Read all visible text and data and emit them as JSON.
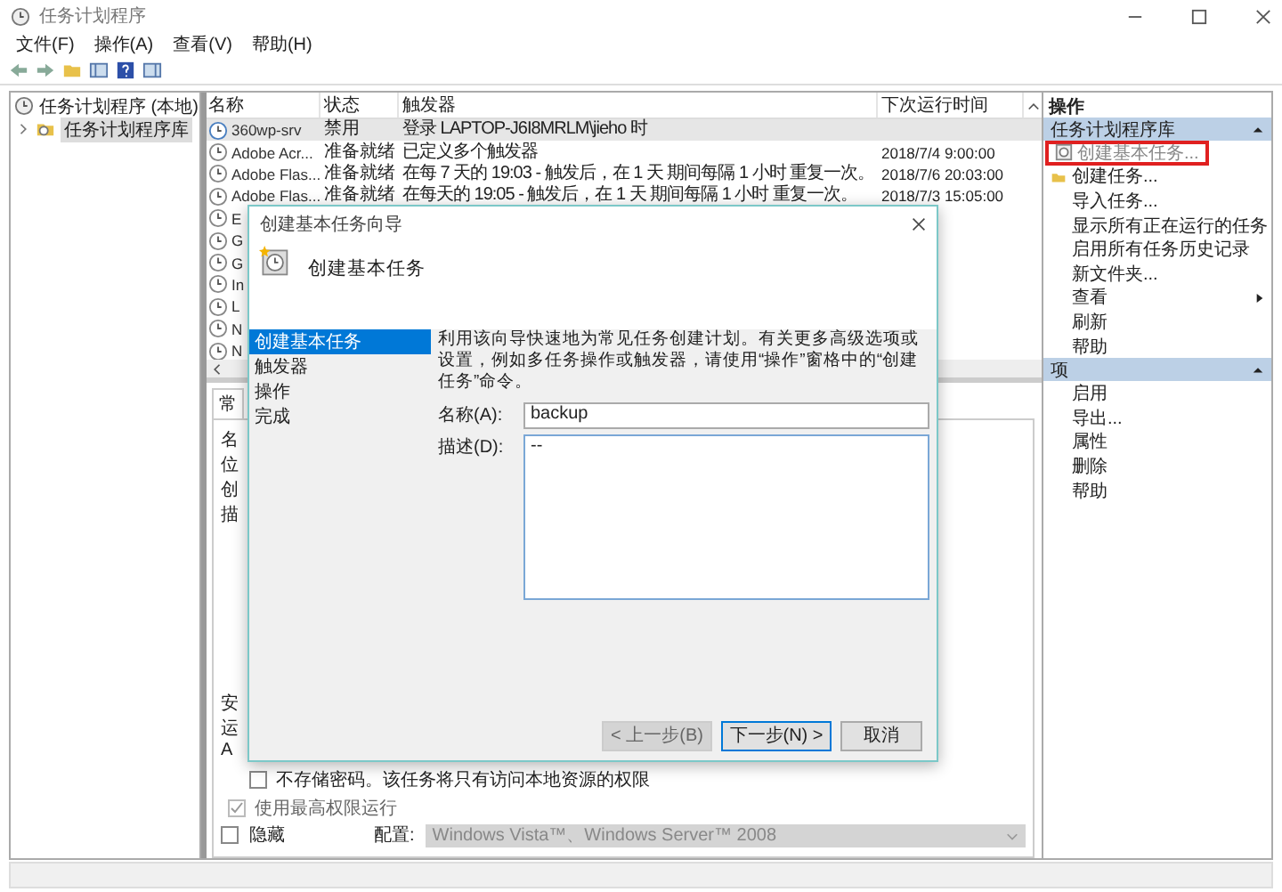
{
  "window": {
    "title": "任务计划程序",
    "menu": [
      "文件(F)",
      "操作(A)",
      "查看(V)",
      "帮助(H)"
    ]
  },
  "tree": {
    "label": "任务计划程序 (本地)",
    "children": [
      {
        "label": "任务计划程序库",
        "selected": true,
        "expanded": false
      }
    ]
  },
  "tasks": {
    "columns": [
      "名称",
      "状态",
      "触发器",
      "下次运行时间"
    ],
    "rows": [
      {
        "name": "360wp-srv",
        "status": "禁用",
        "trigger": "登录 LAPTOP-J6I8MRLM\\jieho 时",
        "selected": true
      },
      {
        "name": "Adobe Acr...",
        "status": "准备就绪",
        "trigger": "已定义多个触发器",
        "next_run": "2018/7/4 9:00:00",
        "selected": false
      },
      {
        "name": "Adobe Flas...",
        "status": "准备就绪",
        "trigger": "在每 7 天的 19:03 - 触发后，在 1 天 期间每隔 1 小时 重复一次。",
        "next_run": "2018/7/6 20:03:00",
        "selected": false
      },
      {
        "name": "Adobe Flas...",
        "status": "准备就绪",
        "trigger": "在每天的 19:05 - 触发后，在 1 天 期间每隔 1 小时 重复一次。",
        "next_run": "2018/7/3 15:05:00",
        "selected": false
      },
      {
        "name": "E",
        "selected": false
      },
      {
        "name": "G",
        "selected": false
      },
      {
        "name": "G",
        "selected": false
      },
      {
        "name": "In",
        "selected": false
      },
      {
        "name": "L",
        "selected": false
      },
      {
        "name": "N",
        "selected": false
      },
      {
        "name": "N",
        "selected": false
      }
    ]
  },
  "details": {
    "tab": "常",
    "labels": [
      "名",
      "位",
      "创",
      "描"
    ],
    "security_labels": [
      "安",
      "运",
      "A"
    ],
    "options": [
      {
        "label": "不存储密码。该任务将只有访问本地资源的权限",
        "checked": false,
        "disabled": false
      },
      {
        "label": "使用最高权限运行",
        "checked": true,
        "disabled": true
      }
    ],
    "hidden": {
      "label": "隐藏",
      "checked": false
    },
    "config": {
      "label": "配置:",
      "value": "Windows Vista™、Windows Server™ 2008",
      "disabled": true
    }
  },
  "actions": {
    "title": "操作",
    "sections": [
      {
        "title": "任务计划程序库",
        "expanded": true,
        "items": [
          {
            "label": "创建基本任务...",
            "kind": "basic-task",
            "highlighted": true
          },
          {
            "label": "创建任务...",
            "kind": "task",
            "highlighted": false
          },
          {
            "label": "导入任务...",
            "kind": "plain",
            "highlighted": false
          },
          {
            "label": "显示所有正在运行的任务",
            "kind": "plain",
            "highlighted": false
          },
          {
            "label": "启用所有任务历史记录",
            "kind": "plain",
            "highlighted": false
          },
          {
            "label": "新文件夹...",
            "kind": "plain",
            "highlighted": false
          },
          {
            "label": "查看",
            "kind": "submenu",
            "highlighted": false
          },
          {
            "label": "刷新",
            "kind": "plain",
            "highlighted": false
          },
          {
            "label": "帮助",
            "kind": "plain",
            "highlighted": false
          }
        ]
      },
      {
        "title": "项",
        "expanded": true,
        "items": [
          {
            "label": "启用",
            "kind": "plain",
            "highlighted": false
          },
          {
            "label": "导出...",
            "kind": "plain",
            "highlighted": false
          },
          {
            "label": "属性",
            "kind": "plain",
            "highlighted": false
          },
          {
            "label": "删除",
            "kind": "plain",
            "highlighted": false
          },
          {
            "label": "帮助",
            "kind": "plain",
            "highlighted": false
          }
        ]
      }
    ]
  },
  "dialog": {
    "title": "创建基本任务向导",
    "heading": "创建基本任务",
    "steps": [
      {
        "label": "创建基本任务",
        "selected": true
      },
      {
        "label": "触发器",
        "selected": false
      },
      {
        "label": "操作",
        "selected": false
      },
      {
        "label": "完成",
        "selected": false
      }
    ],
    "intro": "利用该向导快速地为常见任务创建计划。有关更多高级选项或设置，例如多任务操作或触发器，请使用“操作”窗格中的“创建任务”命令。",
    "name_label": "名称(A):",
    "name_value": "backup",
    "desc_label": "描述(D):",
    "desc_value": "--",
    "buttons": [
      {
        "label": "< 上一步(B)",
        "disabled": true,
        "default": false
      },
      {
        "label": "下一步(N) >",
        "disabled": false,
        "default": true
      },
      {
        "label": "取消",
        "disabled": false,
        "default": false
      }
    ]
  }
}
